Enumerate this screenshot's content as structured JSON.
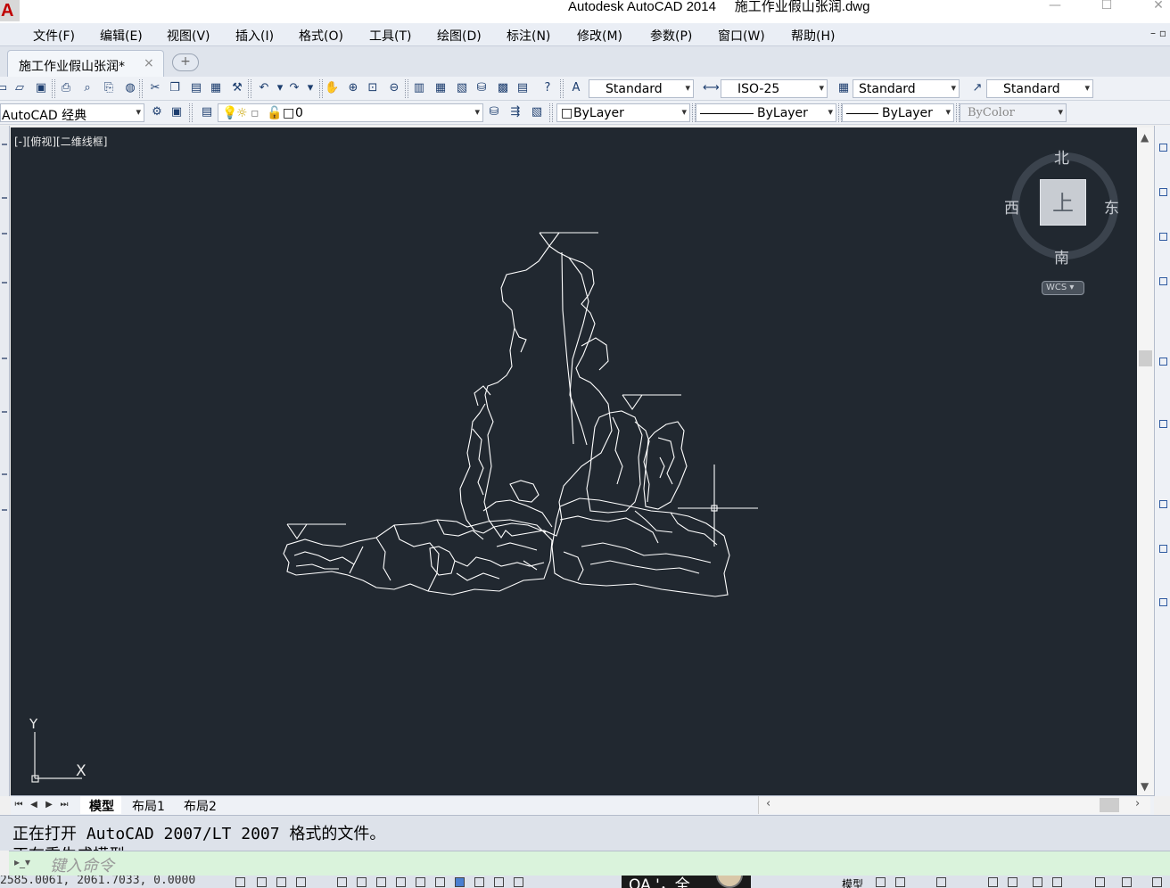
{
  "window": {
    "title": "Autodesk AutoCAD 2014     施工作业假山张润.dwg",
    "logo_letter": "A",
    "minimize_glyph": "—",
    "maximize_glyph": "☐",
    "close_glyph": "✕"
  },
  "menu": {
    "items": [
      "文件(F)",
      "编辑(E)",
      "视图(V)",
      "插入(I)",
      "格式(O)",
      "工具(T)",
      "绘图(D)",
      "标注(N)",
      "修改(M)",
      "参数(P)",
      "窗口(W)",
      "帮助(H)"
    ],
    "mdi_controls": "– ▫"
  },
  "doc_tabs": {
    "active": "施工作业假山张润*",
    "close_glyph": "×",
    "new_tab_glyph": "+"
  },
  "styles_toolbar": {
    "text_style": "Standard",
    "dim_style": "ISO-25",
    "table_style": "Standard",
    "mleader_style": "Standard"
  },
  "layers_toolbar": {
    "workspace": "AutoCAD 经典",
    "current_layer": "0",
    "color": "ByLayer",
    "linetype": "ByLayer",
    "lineweight": "ByLayer",
    "plot_style": "ByColor"
  },
  "viewport": {
    "label": "[-][俯视][二维线框]",
    "viewcube": {
      "north": "北",
      "south": "南",
      "east": "东",
      "west": "西",
      "face": "上",
      "wcs": "WCS"
    },
    "ucs": {
      "x": "X",
      "y": "Y"
    },
    "background_color": "#212830",
    "line_color": "#ffffff"
  },
  "layout_tabs": [
    "模型",
    "布局1",
    "布局2"
  ],
  "command": {
    "history": [
      "正在打开 AutoCAD 2007/LT 2007 格式的文件。",
      "正在重生成模型"
    ],
    "placeholder": "键入命令"
  },
  "status": {
    "coordinates": "2585.0061, 2061.7033, 0.0000",
    "model": "模型",
    "ime_text": "OA '，全"
  }
}
